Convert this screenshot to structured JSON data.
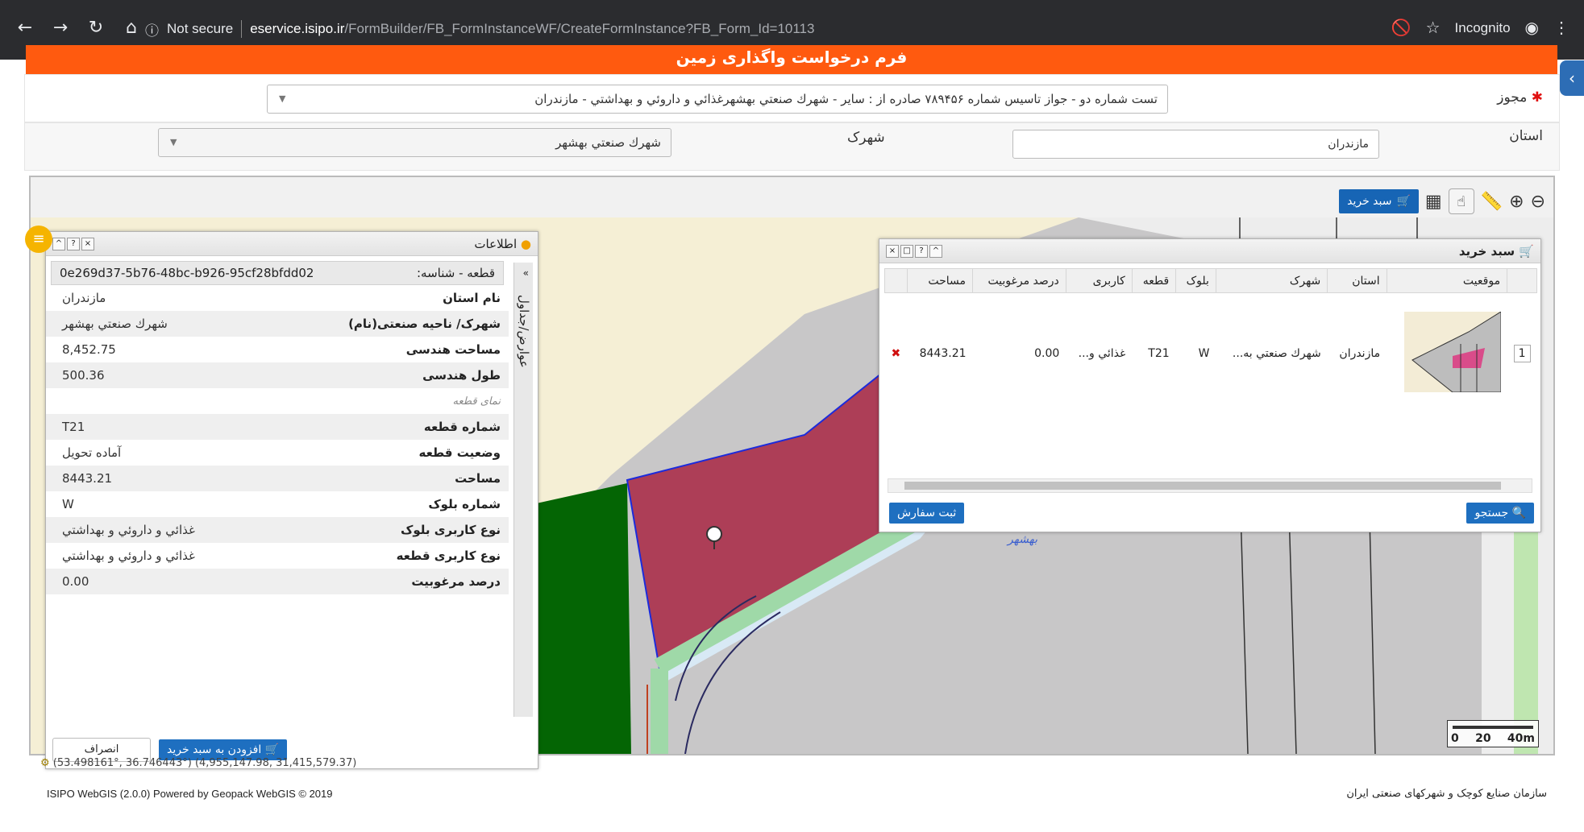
{
  "browser": {
    "security": "Not secure",
    "domain": "eservice.isipo.ir",
    "path": "/FormBuilder/FB_FormInstanceWF/CreateFormInstance?FB_Form_Id=10113",
    "mode": "Incognito"
  },
  "banner": {
    "title": "فرم درخواست واگذاری زمین"
  },
  "form": {
    "license_label": "مجوز",
    "license_value": "تست شماره دو - جواز تاسيس شماره ۷۸۹۴۵۶ صادره از : ساير - شهرك صنعتي بهشهرغذائي و داروئي و بهداشتي - مازندران",
    "province_label": "استان",
    "province_value": "مازندران",
    "town_label": "شهرک",
    "town_value": "شهرك صنعتي بهشهر"
  },
  "toolbar": {
    "buy_label": "سبد خرید"
  },
  "cart": {
    "title": "سبد خرید",
    "columns": [
      "موقعیت",
      "استان",
      "شهرک",
      "بلوک",
      "قطعه",
      "کاربری",
      "درصد مرغوبیت",
      "مساحت"
    ],
    "rows": [
      {
        "index": "1",
        "province": "مازندران",
        "town": "شهرك صنعتي به...",
        "block": "W",
        "plot": "T21",
        "usage": "غذائي و...",
        "quality": "0.00",
        "area": "8443.21",
        "thumb_label": "بهشهر"
      }
    ],
    "search_btn": "جستجو",
    "order_btn": "ثبت سفارش"
  },
  "info": {
    "title": "اطلاعات",
    "plot_id_label": "قطعه - شناسه:",
    "plot_id": "0e269d37-5b76-48bc-b926-95cf28bfdd02",
    "side_tab": "عوارض/جداول",
    "attributes": [
      {
        "k": "نام استان",
        "v": "مازندران"
      },
      {
        "k": "شهرک/ ناحیه صنعتی(نام)",
        "v": "شهرك صنعتي بهشهر"
      },
      {
        "k": "مساحت هندسی",
        "v": "8,452.75"
      },
      {
        "k": "طول هندسی",
        "v": "500.36"
      },
      {
        "k": "نمای قطعه",
        "v": ""
      },
      {
        "k": "شماره قطعه",
        "v": "T21"
      },
      {
        "k": "وضعیت قطعه",
        "v": "آماده تحویل"
      },
      {
        "k": "مساحت",
        "v": "8443.21"
      },
      {
        "k": "شماره بلوک",
        "v": "W"
      },
      {
        "k": "نوع کاربری بلوک",
        "v": "غذائي و داروئي و بهداشتي"
      },
      {
        "k": "نوع کاربری قطعه",
        "v": "غذائي و داروئي و بهداشتي"
      },
      {
        "k": "درصد مرغوبیت",
        "v": "0.00"
      }
    ],
    "add_btn": "افزودن به سبد خرید",
    "cancel_btn": "انصراف"
  },
  "map": {
    "area_label": "بهشهر",
    "coords": "(53.498161°, 36.746443°) (4,955,147.98, 31,415,579.37)",
    "scale_labels": [
      "0",
      "20",
      "40m"
    ]
  },
  "footer": {
    "powered": "ISIPO WebGIS (2.0.0) Powered by  Geopack WebGIS  © 2019",
    "org": "سازمان صنایع کوچک و شهرکهای صنعتی ایران"
  }
}
